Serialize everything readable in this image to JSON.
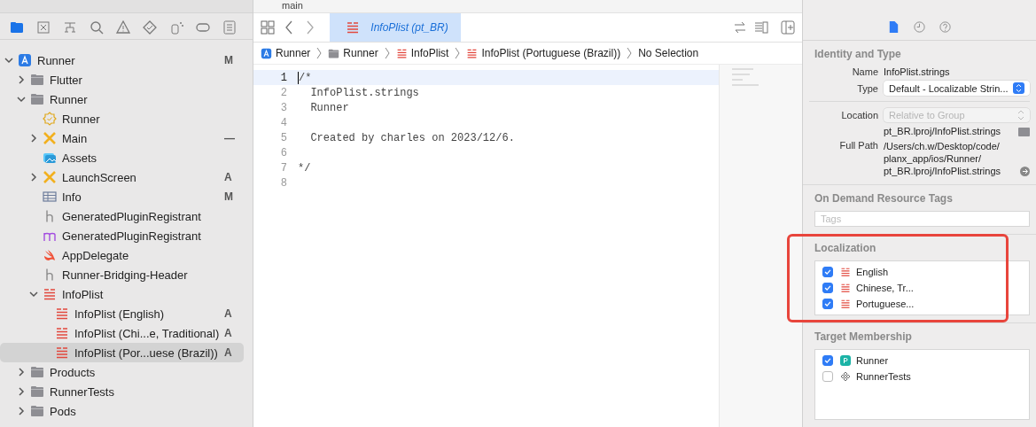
{
  "navigator": {
    "tabs": [
      {
        "selected": true
      },
      {
        "selected": false
      },
      {
        "selected": false
      },
      {
        "selected": false
      },
      {
        "selected": false
      },
      {
        "selected": false
      },
      {
        "selected": false
      },
      {
        "selected": false
      },
      {
        "selected": false
      }
    ],
    "tree": [
      {
        "name": "Runner",
        "kind": "project",
        "expanded": true,
        "badge": "M",
        "selected": false,
        "children": [
          {
            "name": "Flutter",
            "kind": "folder",
            "expanded": false,
            "selected": false
          },
          {
            "name": "Runner",
            "kind": "folder",
            "expanded": true,
            "selected": false,
            "children": [
              {
                "name": "Runner",
                "kind": "entitlements",
                "selected": false
              },
              {
                "name": "Main",
                "kind": "storyboard",
                "expanded": false,
                "badge": "—",
                "selected": false
              },
              {
                "name": "Assets",
                "kind": "assets",
                "selected": false
              },
              {
                "name": "LaunchScreen",
                "kind": "storyboard",
                "expanded": false,
                "badge": "A",
                "selected": false
              },
              {
                "name": "Info",
                "kind": "plist",
                "badge": "M",
                "selected": false
              },
              {
                "name": "GeneratedPluginRegistrant",
                "kind": "header",
                "selected": false
              },
              {
                "name": "GeneratedPluginRegistrant",
                "kind": "objc",
                "selected": false
              },
              {
                "name": "AppDelegate",
                "kind": "swift",
                "selected": false
              },
              {
                "name": "Runner-Bridging-Header",
                "kind": "header",
                "selected": false
              },
              {
                "name": "InfoPlist",
                "kind": "strings",
                "expanded": true,
                "selected": false,
                "children": [
                  {
                    "name": "InfoPlist (English)",
                    "kind": "strings",
                    "badge": "A",
                    "selected": false
                  },
                  {
                    "name": "InfoPlist (Chi...e, Traditional)",
                    "kind": "strings",
                    "badge": "A",
                    "selected": false
                  },
                  {
                    "name": "InfoPlist (Por...uese (Brazil))",
                    "kind": "strings",
                    "badge": "A",
                    "selected": true
                  }
                ]
              }
            ]
          },
          {
            "name": "Products",
            "kind": "folder",
            "expanded": false,
            "selected": false
          },
          {
            "name": "RunnerTests",
            "kind": "folder",
            "expanded": false,
            "selected": false
          },
          {
            "name": "Pods",
            "kind": "folder",
            "expanded": false,
            "selected": false
          }
        ]
      }
    ]
  },
  "toolbar": {
    "branch": "main"
  },
  "editor": {
    "tab": {
      "title": "InfoPlist (pt_BR)",
      "selected": true
    },
    "breadcrumb": [
      {
        "label": "Runner",
        "kind": "project"
      },
      {
        "label": "Runner",
        "kind": "folder"
      },
      {
        "label": "InfoPlist",
        "kind": "strings"
      },
      {
        "label": "InfoPlist (Portuguese (Brazil))",
        "kind": "strings"
      },
      {
        "label": "No Selection",
        "kind": "none"
      }
    ],
    "lines": [
      {
        "number": "1",
        "text": "/*",
        "selected": true
      },
      {
        "number": "2",
        "text": "  InfoPlist.strings",
        "selected": false
      },
      {
        "number": "3",
        "text": "  Runner",
        "selected": false
      },
      {
        "number": "4",
        "selected": false
      },
      {
        "number": "5",
        "text": "  Created by charles on 2023/12/6.",
        "selected": false
      },
      {
        "number": "6",
        "selected": false
      },
      {
        "number": "7",
        "text": "*/",
        "selected": false
      },
      {
        "number": "8",
        "selected": false
      }
    ]
  },
  "inspector": {
    "tabs": [
      {
        "selected": true
      },
      {
        "selected": false
      },
      {
        "selected": false
      }
    ],
    "identity": {
      "title": "Identity and Type",
      "name_label": "Name",
      "name": "InfoPlist.strings",
      "type_label": "Type",
      "type": "Default - Localizable Strin...",
      "location_label": "Location",
      "location": "Relative to Group",
      "location_path": "pt_BR.lproj/InfoPlist.strings",
      "full_path_label": "Full Path",
      "full_path": "/Users/ch.w/Desktop/code/\nplanx_app/ios/Runner/\npt_BR.lproj/InfoPlist.strings"
    },
    "tags": {
      "title": "On Demand Resource Tags",
      "placeholder": "Tags"
    },
    "localization": {
      "title": "Localization",
      "items": [
        {
          "label": "English",
          "checked": true
        },
        {
          "label": "Chinese, Tr...",
          "checked": true
        },
        {
          "label": "Portuguese...",
          "checked": true
        }
      ]
    },
    "membership": {
      "title": "Target Membership",
      "items": [
        {
          "label": "Runner",
          "kind": "app",
          "checked": true
        },
        {
          "label": "RunnerTests",
          "kind": "tests",
          "checked": false
        }
      ]
    }
  }
}
